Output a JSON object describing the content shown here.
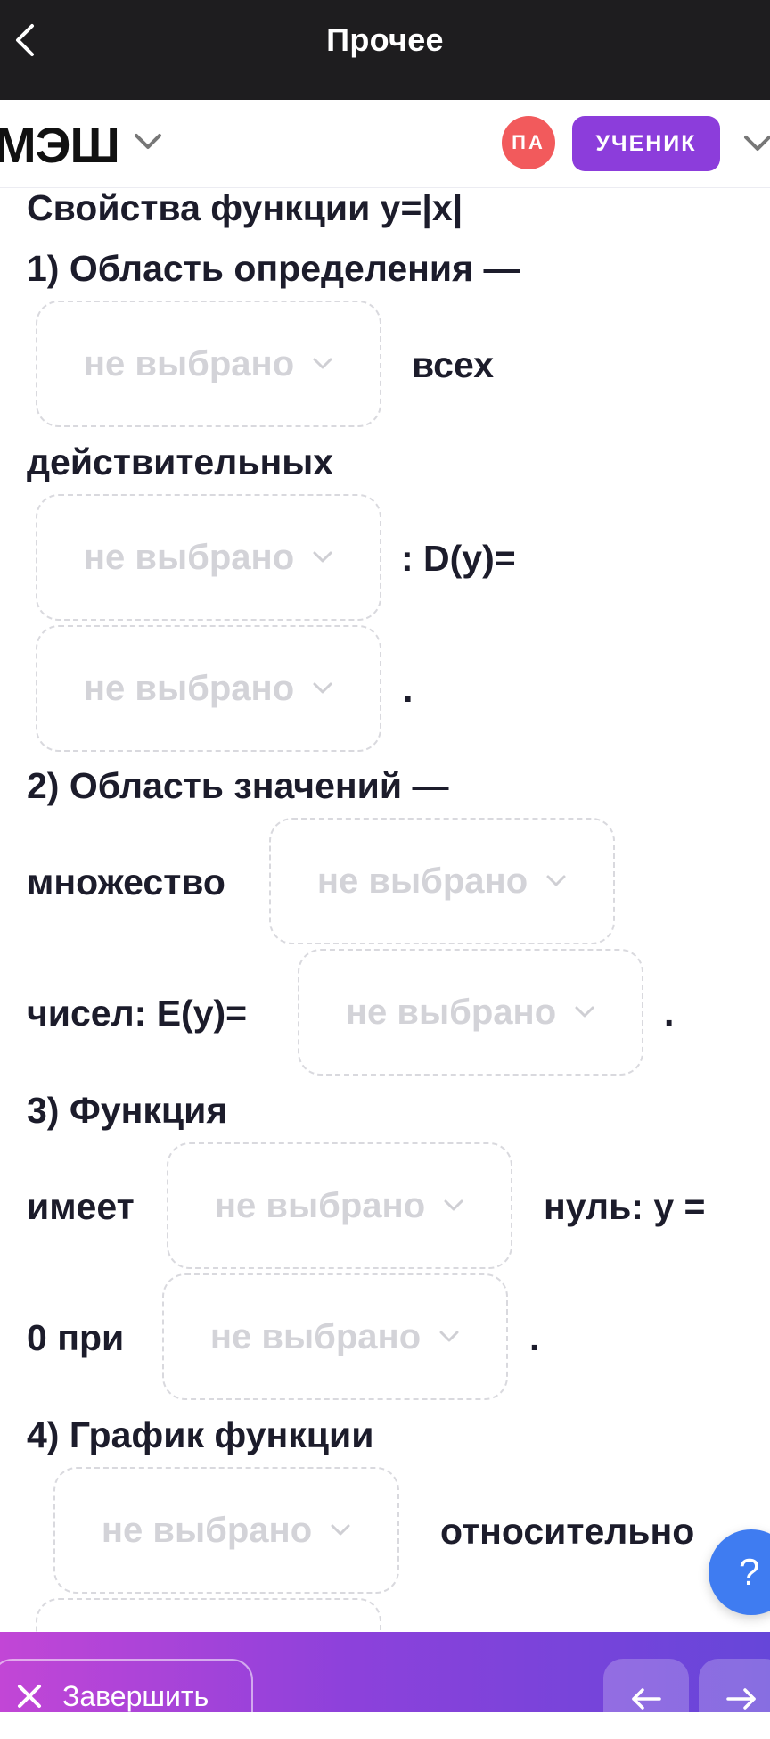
{
  "topbar": {
    "title": "Прочее"
  },
  "header": {
    "logo": "МЭШ",
    "avatar_initials": "ПА",
    "role": "УЧЕНИК"
  },
  "content": {
    "heading": "Свойства функции y=|x|",
    "item1_title": "1) Область определения —",
    "word_all": "всех",
    "word_real": "действительных",
    "d_label": ": D(y)=",
    "period": ".",
    "item2_title": "2) Область значений —",
    "word_set": "множество",
    "e_label": "чисел: E(y)=",
    "item3_title": "3) Функция",
    "word_has": "имеет",
    "zero_label": "нуль: y =",
    "zero_at": "0 при",
    "item4_title": "4) График функции",
    "word_relative": "относительно",
    "placeholder": "не выбрано"
  },
  "help": {
    "label": "?"
  },
  "bottombar": {
    "finish_label": "Завершить"
  },
  "colors": {
    "accent": "#8c3ddb",
    "avatar": "#f25a5c",
    "help": "#3f7cf1",
    "topbar": "#1e1d1f"
  }
}
